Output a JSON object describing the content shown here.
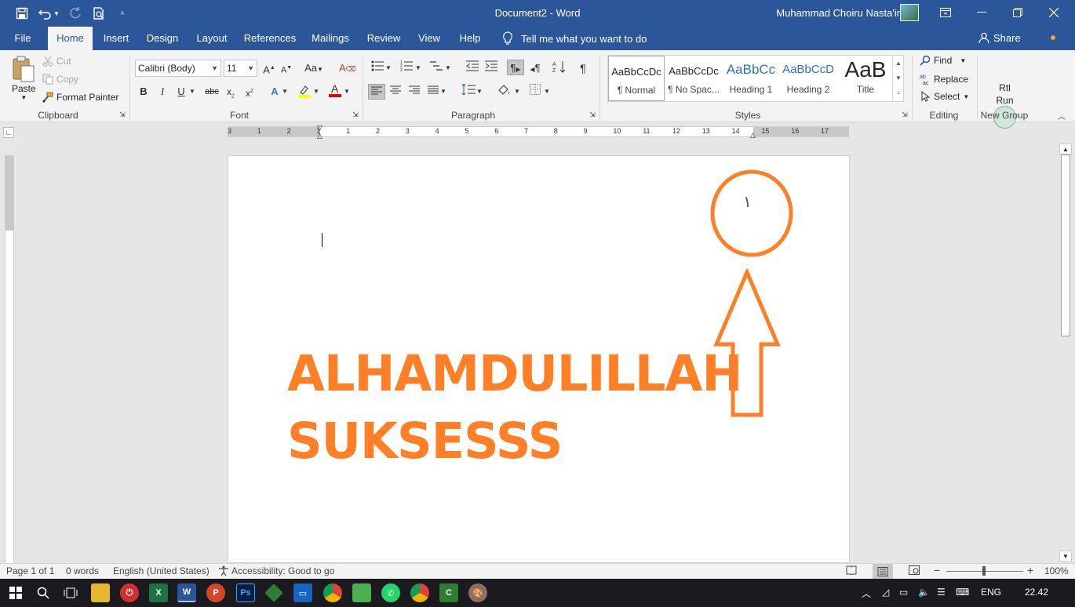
{
  "window": {
    "doc_title": "Document2  -  Word",
    "user_name": "Muhammad Choiru Nasta'in"
  },
  "tabs": [
    {
      "label": "File"
    },
    {
      "label": "Home"
    },
    {
      "label": "Insert"
    },
    {
      "label": "Design"
    },
    {
      "label": "Layout"
    },
    {
      "label": "References"
    },
    {
      "label": "Mailings"
    },
    {
      "label": "Review"
    },
    {
      "label": "View"
    },
    {
      "label": "Help"
    }
  ],
  "tell_me": "Tell me what you want to do",
  "share": "Share",
  "clipboard": {
    "paste": "Paste",
    "cut": "Cut",
    "copy": "Copy",
    "format_painter": "Format Painter",
    "group": "Clipboard"
  },
  "font": {
    "family": "Calibri (Body)",
    "size": "11",
    "group": "Font"
  },
  "paragraph": {
    "group": "Paragraph"
  },
  "styles": {
    "group": "Styles",
    "items": [
      {
        "preview": "AaBbCcDc",
        "name": "¶ Normal"
      },
      {
        "preview": "AaBbCcDc",
        "name": "¶ No Spac..."
      },
      {
        "preview": "AaBbCc",
        "name": "Heading 1"
      },
      {
        "preview": "AaBbCcD",
        "name": "Heading 2"
      },
      {
        "preview": "AaB",
        "name": "Title"
      }
    ]
  },
  "editing": {
    "find": "Find",
    "replace": "Replace",
    "select": "Select",
    "group": "Editing"
  },
  "new_group": {
    "rtl": "Rtl",
    "run": "Run",
    "group": "New Group"
  },
  "ruler_numbers": [
    "3",
    "1",
    "2",
    "1",
    "1",
    "2",
    "3",
    "4",
    "5",
    "6",
    "7",
    "8",
    "9",
    "10",
    "11",
    "12",
    "13",
    "14",
    "15",
    "16",
    "17"
  ],
  "document": {
    "line1": "ALHAMDULILLAH",
    "line2": "SUKSESSS",
    "circle_glyph": "١",
    "accent_color": "#ff7f27"
  },
  "status": {
    "page": "Page 1 of 1",
    "words": "0 words",
    "language": "English (United States)",
    "accessibility": "Accessibility: Good to go",
    "zoom": "100%"
  },
  "taskbar": {
    "lang": "ENG",
    "time": "22.42"
  },
  "colors": {
    "brand": "#2b579a",
    "ribbon": "#f3f3f3"
  }
}
